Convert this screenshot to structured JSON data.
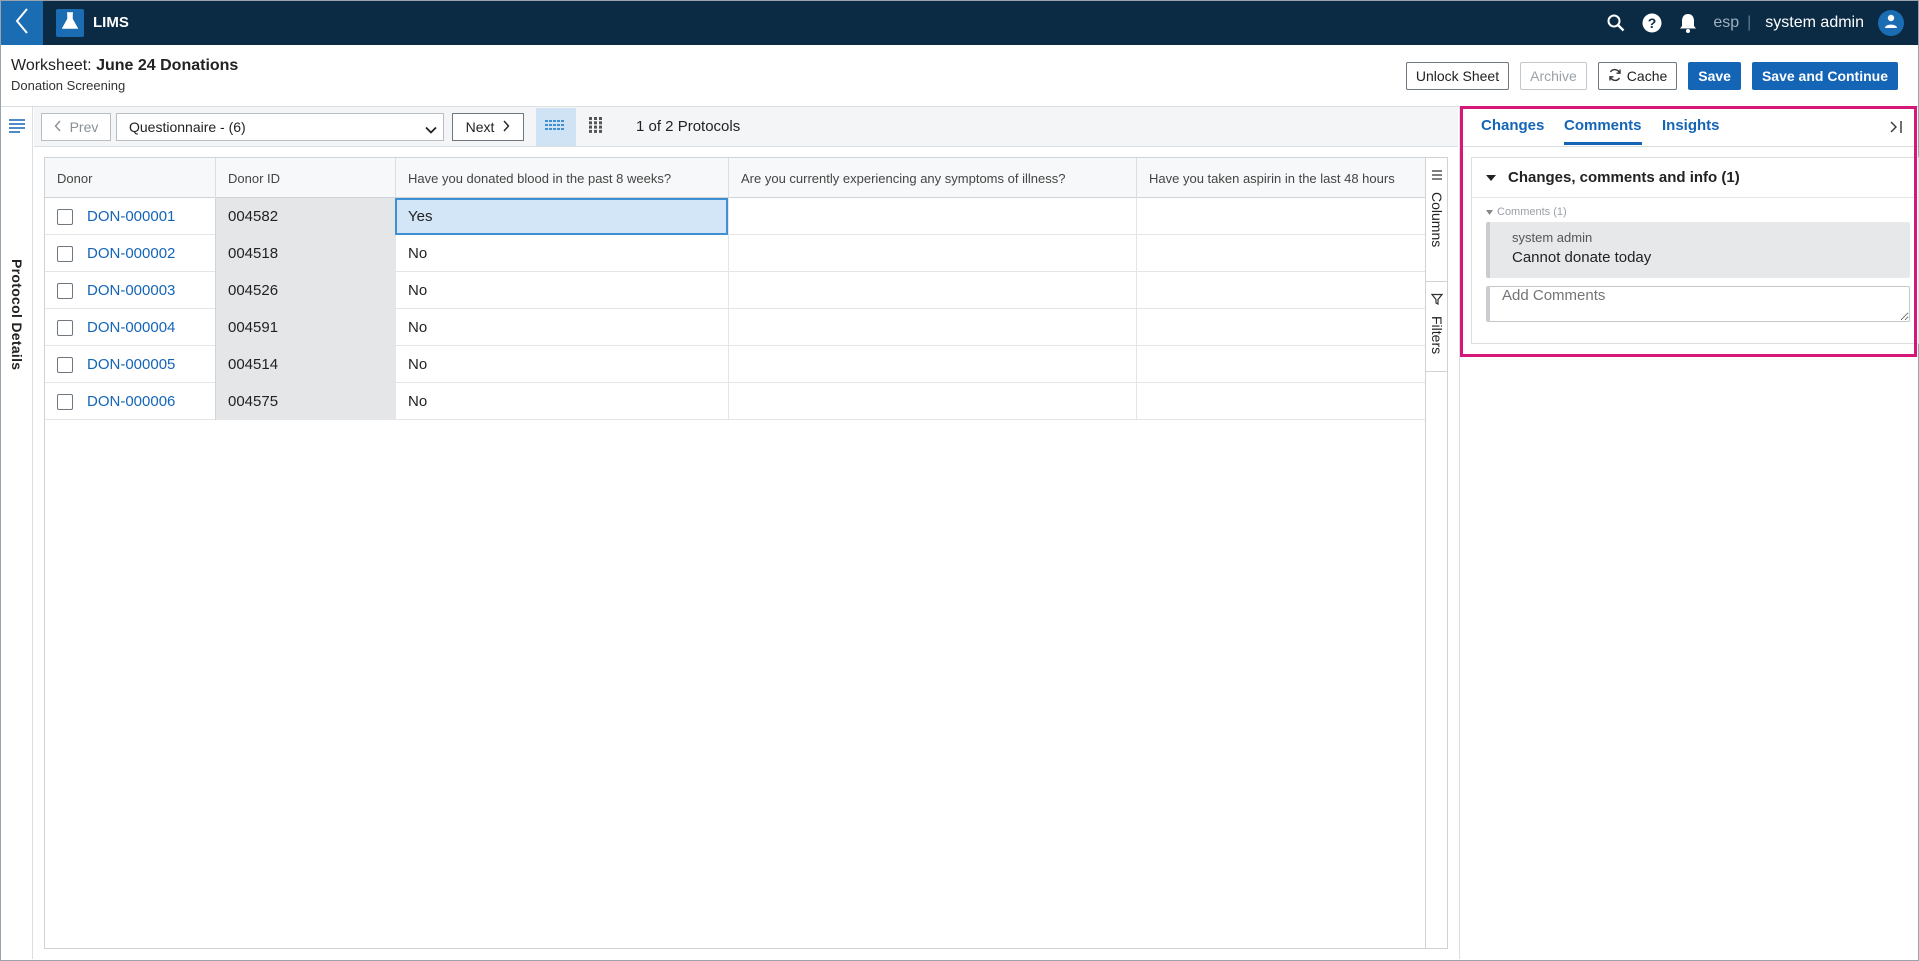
{
  "app": {
    "title": "LIMS",
    "tenant": "esp",
    "separator": "|",
    "username": "system admin"
  },
  "header": {
    "worksheet_prefix": "Worksheet: ",
    "worksheet_name": "June 24 Donations",
    "subtitle": "Donation Screening",
    "buttons": {
      "unlock": "Unlock Sheet",
      "archive": "Archive",
      "cache": "Cache",
      "save": "Save",
      "save_continue": "Save and Continue"
    }
  },
  "left_rail": {
    "label": "Protocol Details"
  },
  "toolbar": {
    "prev": "Prev",
    "protocol_selected": "Questionnaire - (6)",
    "next": "Next",
    "count": "1 of 2 Protocols"
  },
  "grid": {
    "columns": [
      "Donor",
      "Donor ID",
      "Have you donated blood in the past 8 weeks?",
      "Are you currently experiencing any symptoms of illness?",
      "Have you taken aspirin in the last 48 hours"
    ],
    "rows": [
      {
        "donor": "DON-000001",
        "donor_id": "004582",
        "q1": "Yes",
        "q2": "",
        "q3": ""
      },
      {
        "donor": "DON-000002",
        "donor_id": "004518",
        "q1": "No",
        "q2": "",
        "q3": ""
      },
      {
        "donor": "DON-000003",
        "donor_id": "004526",
        "q1": "No",
        "q2": "",
        "q3": ""
      },
      {
        "donor": "DON-000004",
        "donor_id": "004591",
        "q1": "No",
        "q2": "",
        "q3": ""
      },
      {
        "donor": "DON-000005",
        "donor_id": "004514",
        "q1": "No",
        "q2": "",
        "q3": ""
      },
      {
        "donor": "DON-000006",
        "donor_id": "004575",
        "q1": "No",
        "q2": "",
        "q3": ""
      }
    ],
    "side_tabs": {
      "columns": "Columns",
      "filters": "Filters"
    }
  },
  "right_panel": {
    "tabs": [
      "Changes",
      "Comments",
      "Insights"
    ],
    "active_tab": "Comments",
    "section_title": "Changes, comments and info (1)",
    "comments_label": "Comments (1)",
    "comments": [
      {
        "author": "system admin",
        "text": "Cannot donate today"
      }
    ],
    "add_placeholder": "Add Comments"
  },
  "colors": {
    "nav_bg": "#0b2a44",
    "accent": "#1565b7",
    "highlight": "#d6177a",
    "selected_cell": "#d2e6f7"
  },
  "icons": [
    "back-chevron-icon",
    "flask-icon",
    "search-icon",
    "help-icon",
    "bell-icon",
    "user-icon",
    "refresh-icon",
    "list-icon",
    "chevron-left-icon",
    "chevron-down-icon",
    "chevron-right-icon",
    "grid-view-icon",
    "sheet-view-icon",
    "columns-icon",
    "filter-icon",
    "collapse-panel-icon",
    "caret-down-icon"
  ]
}
